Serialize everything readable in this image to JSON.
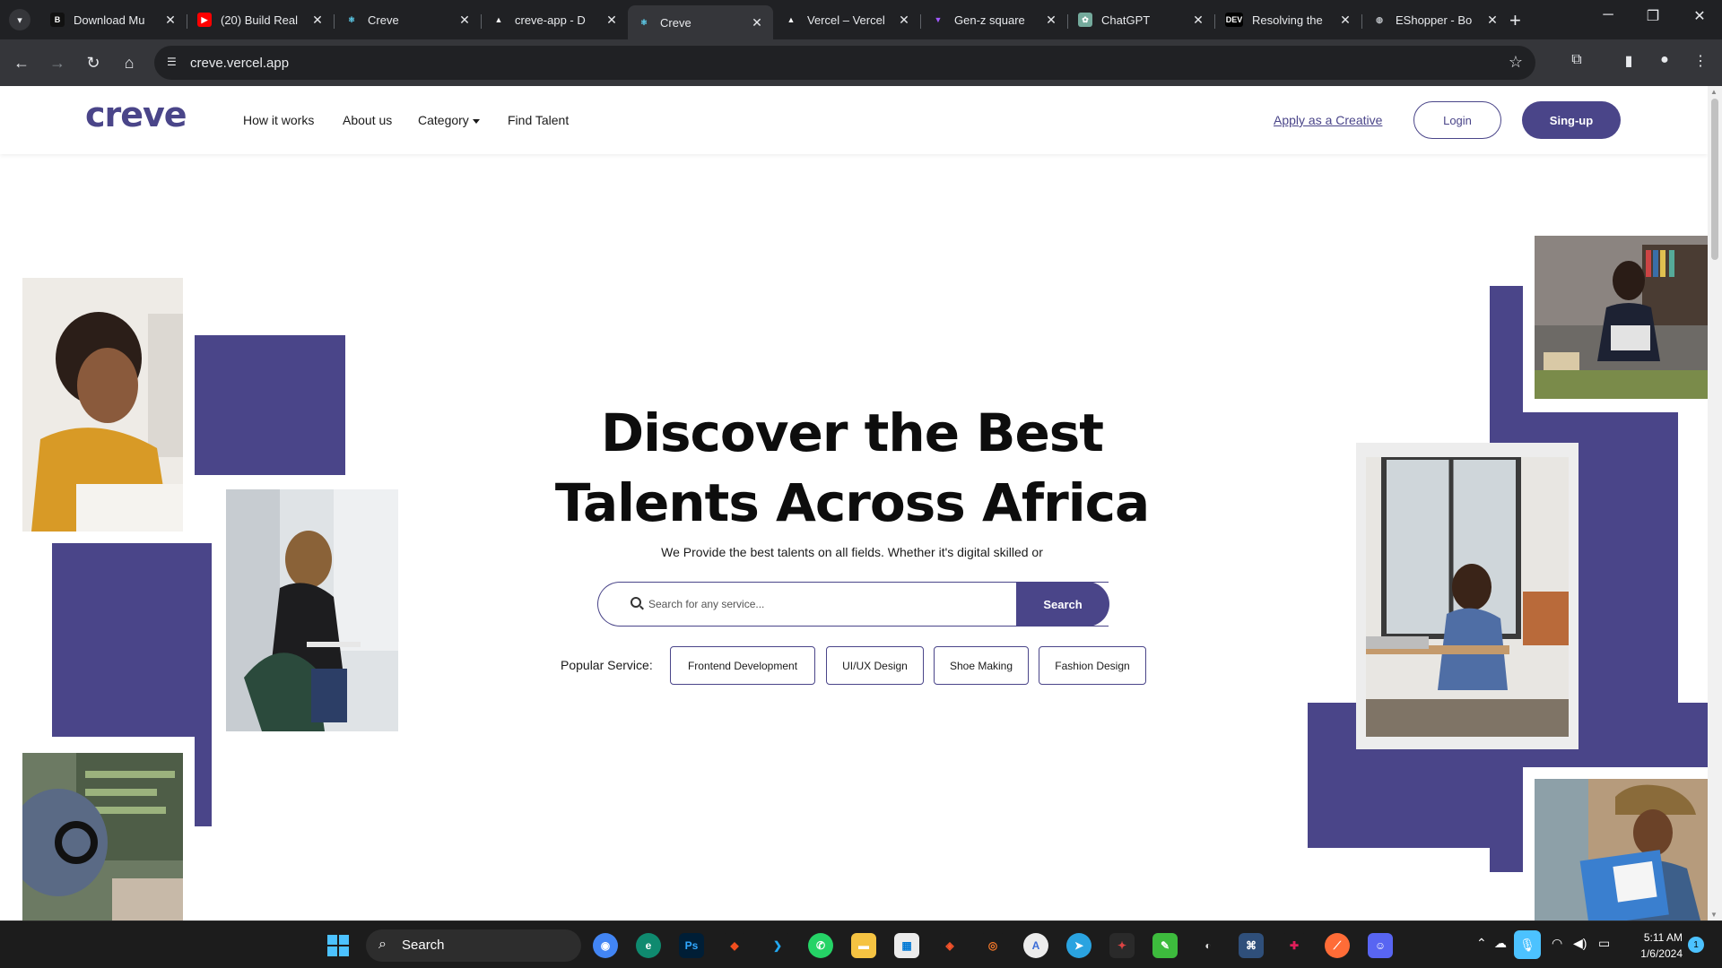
{
  "browser": {
    "tabs": [
      {
        "title": "Download Mu",
        "favicon": "b-icon",
        "color": "#000000"
      },
      {
        "title": "(20) Build Real",
        "favicon": "youtube-icon",
        "color": "#ff0000"
      },
      {
        "title": "Creve",
        "favicon": "react-icon",
        "color": "#61dafb"
      },
      {
        "title": "creve-app - D",
        "favicon": "vercel-icon",
        "color": "#000000"
      },
      {
        "title": "Creve",
        "favicon": "react-icon",
        "color": "#61dafb",
        "active": true
      },
      {
        "title": "Vercel – Vercel",
        "favicon": "vercel-icon",
        "color": "#000000"
      },
      {
        "title": "Gen-z square",
        "favicon": "vite-icon",
        "color": "#a259ff"
      },
      {
        "title": "ChatGPT",
        "favicon": "chatgpt-icon",
        "color": "#74aa9c"
      },
      {
        "title": "Resolving the",
        "favicon": "dev-icon",
        "color": "#000000"
      },
      {
        "title": "EShopper - Bo",
        "favicon": "globe-icon",
        "color": "#5f6368"
      }
    ],
    "url": "creve.vercel.app"
  },
  "site": {
    "logo": "creve",
    "nav": {
      "how": "How it works",
      "about": "About us",
      "category": "Category",
      "find": "Find Talent"
    },
    "apply": "Apply as a Creative",
    "login": "Login",
    "signup": "Sing-up",
    "brand_color": "#4a4589"
  },
  "hero": {
    "title_line1": "Discover the Best",
    "title_line2": "Talents Across Africa",
    "subtitle": "We Provide the best talents on all fields. Whether it's digital skilled or",
    "search_placeholder": "Search for any service...",
    "search_button": "Search",
    "popular_label": "Popular Service:",
    "services": [
      "Frontend Development",
      "UI/UX Design",
      "Shoe Making",
      "Fashion Design"
    ]
  },
  "taskbar": {
    "search_label": "Search",
    "apps": [
      "chrome-icon",
      "edge-icon",
      "photoshop-icon",
      "figma-icon",
      "vscode-icon",
      "whatsapp-icon",
      "file-explorer-icon",
      "store-icon",
      "brave-icon",
      "blender-icon",
      "app-icon",
      "telegram-icon",
      "game-icon",
      "notes-icon",
      "obs-icon",
      "workbench-icon",
      "slack-icon",
      "postman-icon",
      "discord-icon"
    ],
    "time": "5:11 AM",
    "date": "1/6/2024",
    "notifications": "1"
  }
}
